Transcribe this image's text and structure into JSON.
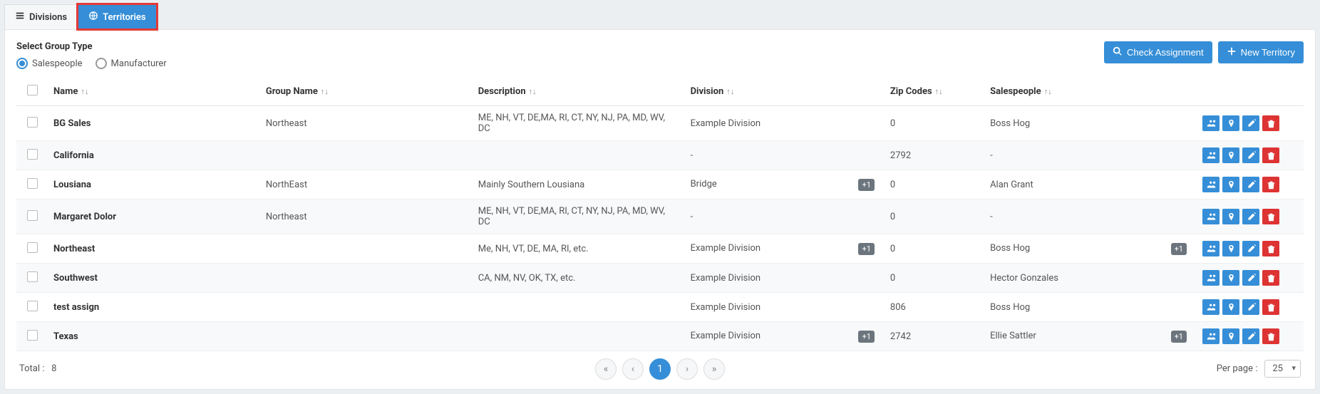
{
  "tabs": {
    "divisions": "Divisions",
    "territories": "Territories"
  },
  "group_type": {
    "label": "Select Group Type",
    "options": {
      "salespeople": "Salespeople",
      "manufacturer": "Manufacturer"
    },
    "selected": "salespeople"
  },
  "buttons": {
    "check_assignment": "Check Assignment",
    "new_territory": "New Territory"
  },
  "columns": {
    "name": "Name",
    "group_name": "Group Name",
    "description": "Description",
    "division": "Division",
    "zip_codes": "Zip Codes",
    "salespeople": "Salespeople"
  },
  "rows": [
    {
      "name": "BG Sales",
      "group_name": "Northeast",
      "description": "ME, NH, VT, DE,MA, RI, CT, NY, NJ, PA, MD, WV, DC",
      "division": "Example Division",
      "division_extra": false,
      "zip": "0",
      "sales": "Boss Hog",
      "sales_extra": false
    },
    {
      "name": "California",
      "group_name": "",
      "description": "",
      "division": "-",
      "division_extra": false,
      "zip": "2792",
      "sales": "-",
      "sales_extra": false
    },
    {
      "name": "Lousiana",
      "group_name": "NorthEast",
      "description": "Mainly Southern Lousiana",
      "division": "Bridge",
      "division_extra": true,
      "zip": "0",
      "sales": "Alan Grant",
      "sales_extra": false
    },
    {
      "name": "Margaret Dolor",
      "group_name": "Northeast",
      "description": "ME, NH, VT, DE,MA, RI, CT, NY, NJ, PA, MD, WV, DC",
      "division": "-",
      "division_extra": false,
      "zip": "0",
      "sales": "-",
      "sales_extra": false
    },
    {
      "name": "Northeast",
      "group_name": "",
      "description": "Me, NH, VT, DE, MA, RI, etc.",
      "division": "Example Division",
      "division_extra": true,
      "zip": "0",
      "sales": "Boss Hog",
      "sales_extra": true
    },
    {
      "name": "Southwest",
      "group_name": "",
      "description": "CA, NM, NV, OK, TX, etc.",
      "division": "Example Division",
      "division_extra": false,
      "zip": "0",
      "sales": "Hector Gonzales",
      "sales_extra": false
    },
    {
      "name": "test assign",
      "group_name": "",
      "description": "",
      "division": "Example Division",
      "division_extra": false,
      "zip": "806",
      "sales": "Boss Hog",
      "sales_extra": false
    },
    {
      "name": "Texas",
      "group_name": "",
      "description": "",
      "division": "Example Division",
      "division_extra": true,
      "zip": "2742",
      "sales": "Ellie Sattler",
      "sales_extra": true
    }
  ],
  "badge_plus1": "+1",
  "footer": {
    "total_label": "Total :",
    "total_value": "8",
    "page": "1",
    "per_page_label": "Per page :",
    "per_page_value": "25"
  }
}
